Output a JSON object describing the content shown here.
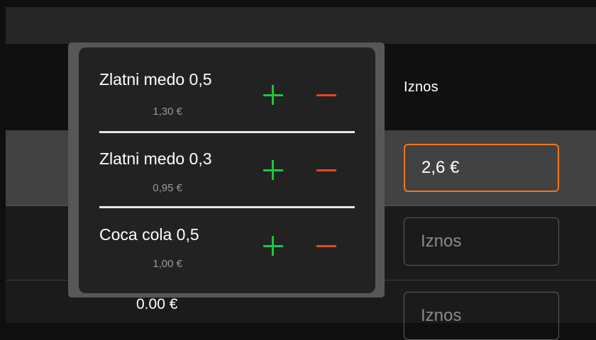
{
  "table": {
    "amount_header": "Iznos",
    "rows": [
      {
        "amount_value": "2,6 €",
        "amount_placeholder": "Iznos"
      },
      {
        "amount_value": "",
        "amount_placeholder": "Iznos"
      },
      {
        "total": "0.00 €",
        "amount_value": "",
        "amount_placeholder": "Iznos"
      }
    ]
  },
  "popup": {
    "items": [
      {
        "name": "Zlatni medo 0,5",
        "price": "1,30 €"
      },
      {
        "name": "Zlatni medo 0,3",
        "price": "0,95 €"
      },
      {
        "name": "Coca cola 0,5",
        "price": "1,00 €"
      }
    ]
  },
  "colors": {
    "accent": "#f07818",
    "plus": "#1ec63b",
    "minus": "#e8441c"
  }
}
